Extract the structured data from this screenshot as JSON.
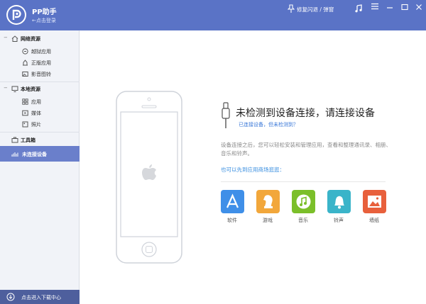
{
  "window": {
    "title": "PP助手",
    "login": "←点击登录"
  },
  "header": {
    "fix_flash": "修复闪退 / 弹窗",
    "icons": {
      "pin": "pin-icon",
      "music": "music-note-icon",
      "menu": "menu-icon",
      "minimize": "minimize-icon",
      "maximize": "maximize-icon",
      "close": "close-icon"
    }
  },
  "colors": {
    "header": "#5a73c6",
    "sidebar_active": "#6a7fcb",
    "footer": "#4e5f9d",
    "link": "#3a78d8"
  },
  "sidebar": {
    "network": {
      "title": "网络资源",
      "items": [
        {
          "label": "越狱应用"
        },
        {
          "label": "正版应用"
        },
        {
          "label": "影音图铃"
        }
      ]
    },
    "local": {
      "title": "本地资源",
      "items": [
        {
          "label": "应用"
        },
        {
          "label": "媒体"
        },
        {
          "label": "照片"
        }
      ]
    },
    "toolbox": "工具箱",
    "active": "未连接设备",
    "footer": "点击进入下载中心"
  },
  "main": {
    "headline": "未检测到设备连接，请连接设备",
    "not_detected": "已连接设备，但未检测到？",
    "description": "设备连接之后，您可以轻松安装和管理应用，查看和整理通讯录、相册、音乐和铃声。",
    "store_prompt": "也可以先到应用商场逛逛：",
    "apps": [
      {
        "label": "软件",
        "color": "#3f8fe8"
      },
      {
        "label": "游戏",
        "color": "#f2a73b"
      },
      {
        "label": "音乐",
        "color": "#7bbf2a"
      },
      {
        "label": "铃声",
        "color": "#3ab4c9"
      },
      {
        "label": "墙纸",
        "color": "#e8603c"
      }
    ]
  }
}
